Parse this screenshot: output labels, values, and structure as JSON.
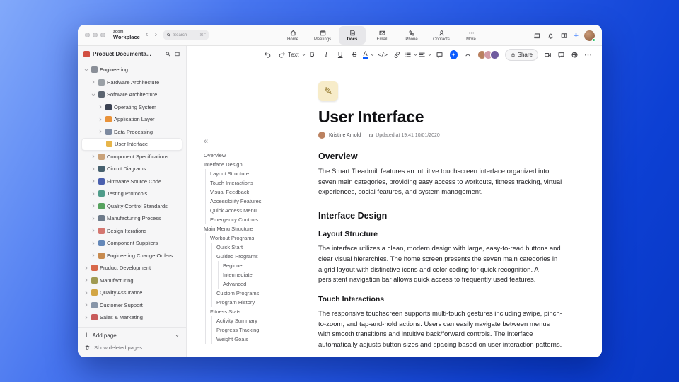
{
  "colors": {
    "accent": "#0B5CFF",
    "status_online": "#27c26c",
    "outline_guide": "#e3e3e6"
  },
  "titlebar": {
    "brand_top": "zoom",
    "brand_bottom": "Workplace",
    "search_placeholder": "Search",
    "search_shortcut": "⌘F"
  },
  "topnav": {
    "tabs": [
      {
        "label": "Home",
        "icon": "home-icon",
        "active": false
      },
      {
        "label": "Meetings",
        "icon": "calendar-icon",
        "active": false
      },
      {
        "label": "Docs",
        "icon": "docs-icon",
        "active": true
      },
      {
        "label": "Email",
        "icon": "mail-icon",
        "active": false
      },
      {
        "label": "Phone",
        "icon": "phone-icon",
        "active": false
      },
      {
        "label": "Contacts",
        "icon": "contacts-icon",
        "active": false
      },
      {
        "label": "More",
        "icon": "more-icon",
        "active": false
      }
    ]
  },
  "sidebar": {
    "workspace_label": "Product Documenta...",
    "workspace_icon_color": "#d14f42",
    "tree": [
      {
        "label": "Engineering",
        "level": 0,
        "chevron": "down",
        "icon": "gear-icon",
        "icon_color": "#8a8f98"
      },
      {
        "label": "Hardware Architecture",
        "level": 1,
        "chevron": "right",
        "icon": "wrench-icon",
        "icon_color": "#9aa0a6"
      },
      {
        "label": "Software Architecture",
        "level": 1,
        "chevron": "down",
        "icon": "laptop-icon",
        "icon_color": "#5b6470"
      },
      {
        "label": "Operating System",
        "level": 2,
        "chevron": "right",
        "icon": "system-icon",
        "icon_color": "#3b4252"
      },
      {
        "label": "Application Layer",
        "level": 2,
        "chevron": "right",
        "icon": "package-icon",
        "icon_color": "#e8923a"
      },
      {
        "label": "Data Processing",
        "level": 2,
        "chevron": "right",
        "icon": "data-chart-icon",
        "icon_color": "#7d8aa0"
      },
      {
        "label": "User Interface",
        "level": 2,
        "chevron": null,
        "icon": "memo-icon",
        "icon_color": "#e7b54a",
        "selected": true
      },
      {
        "label": "Component Specifications",
        "level": 1,
        "chevron": "right",
        "icon": "clipboard-icon",
        "icon_color": "#c9a27a"
      },
      {
        "label": "Circuit Diagrams",
        "level": 1,
        "chevron": "right",
        "icon": "plug-icon",
        "icon_color": "#46606e"
      },
      {
        "label": "Firmware Source Code",
        "level": 1,
        "chevron": "right",
        "icon": "floppy-icon",
        "icon_color": "#4a5fae"
      },
      {
        "label": "Testing Protocols",
        "level": 1,
        "chevron": "right",
        "icon": "testtube-icon",
        "icon_color": "#4f9c8a"
      },
      {
        "label": "Quality Control Standards",
        "level": 1,
        "chevron": "right",
        "icon": "check-icon",
        "icon_color": "#58a35f"
      },
      {
        "label": "Manufacturing Process",
        "level": 1,
        "chevron": "right",
        "icon": "factory-icon",
        "icon_color": "#6e7b8a"
      },
      {
        "label": "Design Iterations",
        "level": 1,
        "chevron": "right",
        "icon": "palette-icon",
        "icon_color": "#d4766f"
      },
      {
        "label": "Component Suppliers",
        "level": 1,
        "chevron": "right",
        "icon": "building-icon",
        "icon_color": "#6487b8"
      },
      {
        "label": "Engineering Change Orders",
        "level": 1,
        "chevron": "right",
        "icon": "change-order-icon",
        "icon_color": "#c78a4e"
      },
      {
        "label": "Product Development",
        "level": 0,
        "chevron": "right",
        "icon": "rocket-icon",
        "icon_color": "#d8684a"
      },
      {
        "label": "Manufacturing",
        "level": 0,
        "chevron": "right",
        "icon": "factory-icon",
        "icon_color": "#a09a52"
      },
      {
        "label": "Quality Assurance",
        "level": 0,
        "chevron": "right",
        "icon": "badge-icon",
        "icon_color": "#d2a544"
      },
      {
        "label": "Customer Support",
        "level": 0,
        "chevron": "right",
        "icon": "speech-icon",
        "icon_color": "#8795a8"
      },
      {
        "label": "Sales & Marketing",
        "level": 0,
        "chevron": "right",
        "icon": "trend-icon",
        "icon_color": "#c85b5b"
      }
    ],
    "add_page_label": "Add page",
    "show_deleted_label": "Show deleted pages"
  },
  "outline": {
    "items": [
      {
        "label": "Overview",
        "level": 0
      },
      {
        "label": "Interface Design",
        "level": 0
      },
      {
        "label": "Layout Structure",
        "level": 1
      },
      {
        "label": "Touch Interactions",
        "level": 1
      },
      {
        "label": "Visual Feedback",
        "level": 1
      },
      {
        "label": "Accessibility Features",
        "level": 1
      },
      {
        "label": "Quick Access Menu",
        "level": 1
      },
      {
        "label": "Emergency Controls",
        "level": 1
      },
      {
        "label": "Main Menu Structure",
        "level": 0
      },
      {
        "label": "Workout Programs",
        "level": 1
      },
      {
        "label": "Quick Start",
        "level": 2
      },
      {
        "label": "Guided Programs",
        "level": 2
      },
      {
        "label": "Beginner",
        "level": 3
      },
      {
        "label": "Intermediate",
        "level": 3
      },
      {
        "label": "Advanced",
        "level": 3
      },
      {
        "label": "Custom Programs",
        "level": 2
      },
      {
        "label": "Program History",
        "level": 2
      },
      {
        "label": "Fitness Stats",
        "level": 1
      },
      {
        "label": "Activity Summary",
        "level": 2
      },
      {
        "label": "Progress Tracking",
        "level": 2
      },
      {
        "label": "Weight Goals",
        "level": 2
      }
    ]
  },
  "editor_toolbar": {
    "buttons": [
      {
        "name": "undo"
      },
      {
        "name": "redo"
      },
      {
        "name": "text-style",
        "label": "Text",
        "caret": true
      },
      {
        "name": "bold",
        "label": "B"
      },
      {
        "name": "italic",
        "label": "I"
      },
      {
        "name": "underline",
        "label": "U"
      },
      {
        "name": "strikethrough",
        "label": "S"
      },
      {
        "name": "text-color",
        "label": "A",
        "caret": true
      },
      {
        "name": "code",
        "label": "</>"
      },
      {
        "name": "link"
      },
      {
        "name": "bulleted-list",
        "caret": true
      },
      {
        "name": "alignment",
        "caret": true
      },
      {
        "name": "comment"
      },
      {
        "name": "ai-companion"
      },
      {
        "name": "collapse-toolbar"
      }
    ],
    "share_label": "Share",
    "avatars": [
      "#b9805f",
      "#d29aa6",
      "#6f5a9e"
    ]
  },
  "document": {
    "title": "User Interface",
    "author": "Kristine Arnold",
    "updated": "Updated at 19:41 10/01/2020",
    "sections": [
      {
        "type": "h1",
        "text": "Overview"
      },
      {
        "type": "p",
        "text": "The Smart Treadmill features an intuitive touchscreen interface organized into seven main categories, providing easy access to workouts, fitness tracking, virtual experiences, social features, and system management."
      },
      {
        "type": "h1",
        "text": "Interface Design"
      },
      {
        "type": "h2",
        "text": "Layout Structure"
      },
      {
        "type": "p",
        "text": "The interface utilizes a clean, modern design with large, easy-to-read buttons and clear visual hierarchies. The home screen presents the seven main categories in a grid layout with distinctive icons and color coding for quick recognition. A persistent navigation bar allows quick access to frequently used features."
      },
      {
        "type": "h2",
        "text": "Touch Interactions"
      },
      {
        "type": "p",
        "text": "The responsive touchscreen supports multi-touch gestures including swipe, pinch-to-zoom, and tap-and-hold actions. Users can easily navigate between menus with smooth transitions and intuitive back/forward controls. The interface automatically adjusts button sizes and spacing based on user interaction patterns."
      }
    ]
  }
}
